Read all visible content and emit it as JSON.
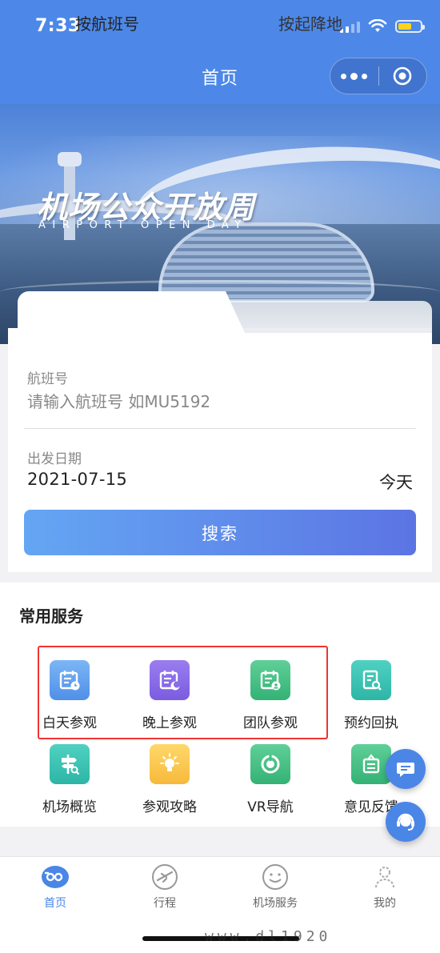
{
  "status_bar": {
    "time": "7:33"
  },
  "nav": {
    "title": "首页"
  },
  "banner": {
    "title": "机场公众开放周",
    "subtitle": "AIRPORT OPEN DAY"
  },
  "search": {
    "tabs": [
      {
        "label": "按航班号",
        "active": true
      },
      {
        "label": "按起降地",
        "active": false
      }
    ],
    "flight_label": "航班号",
    "flight_placeholder": "请输入航班号 如MU5192",
    "date_label": "出发日期",
    "date_value": "2021-07-15",
    "date_today": "今天",
    "button_label": "搜索"
  },
  "services": {
    "title": "常用服务",
    "items": [
      {
        "label": "白天参观",
        "icon": "calendar-day-icon",
        "color": "#5b9af0"
      },
      {
        "label": "晚上参观",
        "icon": "calendar-night-icon",
        "color": "#8a6ce8"
      },
      {
        "label": "团队参观",
        "icon": "calendar-group-icon",
        "color": "#43be84"
      },
      {
        "label": "预约回执",
        "icon": "receipt-search-icon",
        "color": "#3cc2b3"
      },
      {
        "label": "机场概览",
        "icon": "signpost-icon",
        "color": "#3cc2b3"
      },
      {
        "label": "参观攻略",
        "icon": "lightbulb-icon",
        "color": "#f8c64a"
      },
      {
        "label": "VR导航",
        "icon": "vr-compass-icon",
        "color": "#43be84"
      },
      {
        "label": "意见反馈",
        "icon": "feedback-icon",
        "color": "#43be84"
      }
    ]
  },
  "tabbar": {
    "items": [
      {
        "label": "首页",
        "icon": "home-logo-icon",
        "active": true
      },
      {
        "label": "行程",
        "icon": "plane-icon",
        "active": false
      },
      {
        "label": "机场服务",
        "icon": "smile-icon",
        "active": false
      },
      {
        "label": "我的",
        "icon": "user-icon",
        "active": false
      }
    ]
  },
  "watermark": "www.dl1920"
}
